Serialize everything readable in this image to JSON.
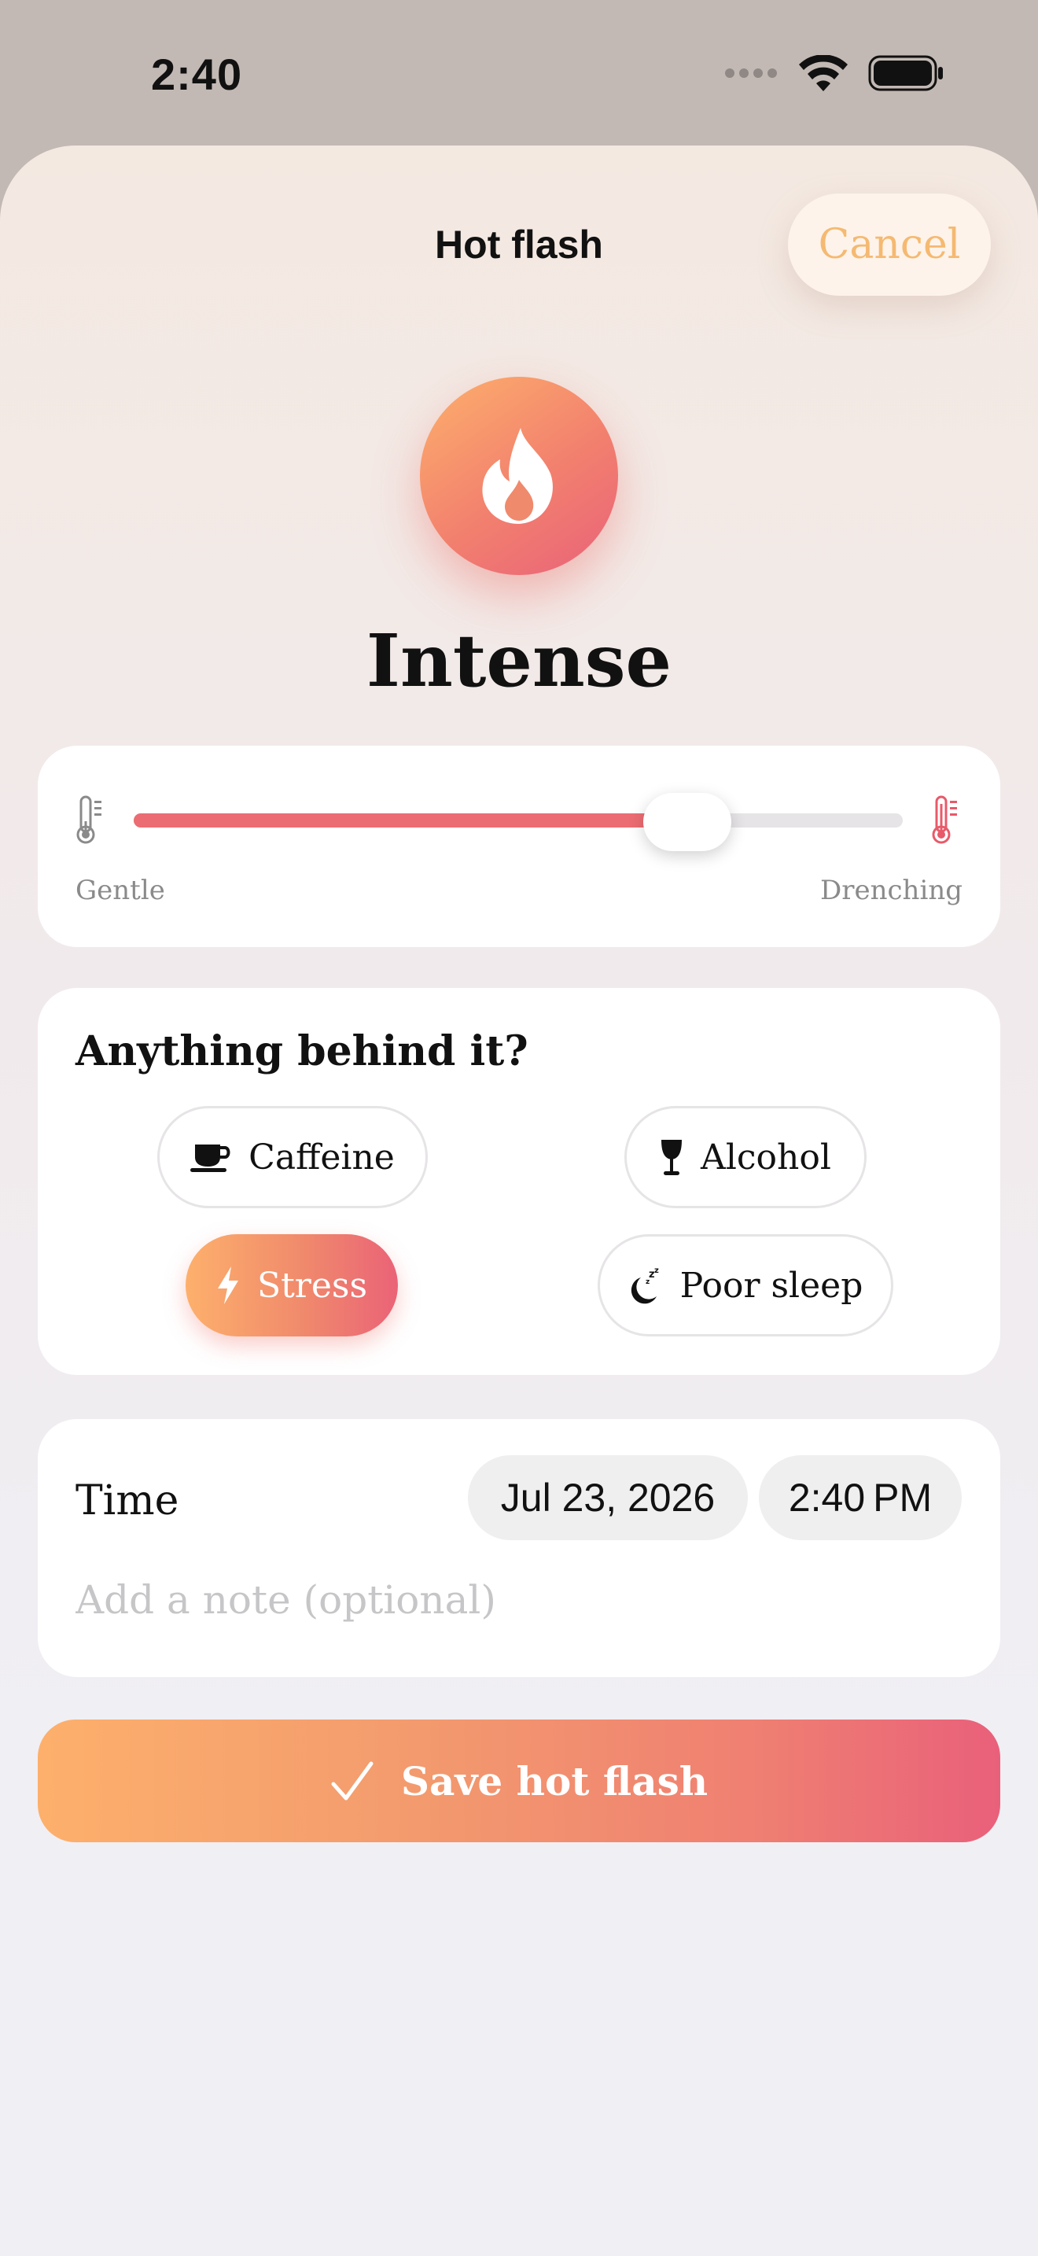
{
  "status_bar": {
    "time": "2:40"
  },
  "header": {
    "title": "Hot flash",
    "cancel_label": "Cancel"
  },
  "intensity": {
    "label": "Intense",
    "slider_value_fraction": 0.72,
    "min_label": "Gentle",
    "max_label": "Drenching"
  },
  "triggers": {
    "title": "Anything behind it?",
    "chips": [
      {
        "label": "Caffeine",
        "icon": "coffee-cup-icon",
        "selected": false
      },
      {
        "label": "Alcohol",
        "icon": "wine-glass-icon",
        "selected": false
      },
      {
        "label": "Stress",
        "icon": "bolt-icon",
        "selected": true
      },
      {
        "label": "Poor sleep",
        "icon": "moon-zzz-icon",
        "selected": false
      }
    ]
  },
  "time": {
    "label": "Time",
    "date": "Jul 23, 2026",
    "clock": "2:40 PM",
    "note_placeholder": "Add a note (optional)",
    "note_value": ""
  },
  "save": {
    "label": "Save hot flash"
  },
  "colors": {
    "accent_orange": "#fdb06c",
    "accent_pink": "#e9627a",
    "cancel_text": "#f5b971",
    "slider_fill": "#ec6c73"
  }
}
